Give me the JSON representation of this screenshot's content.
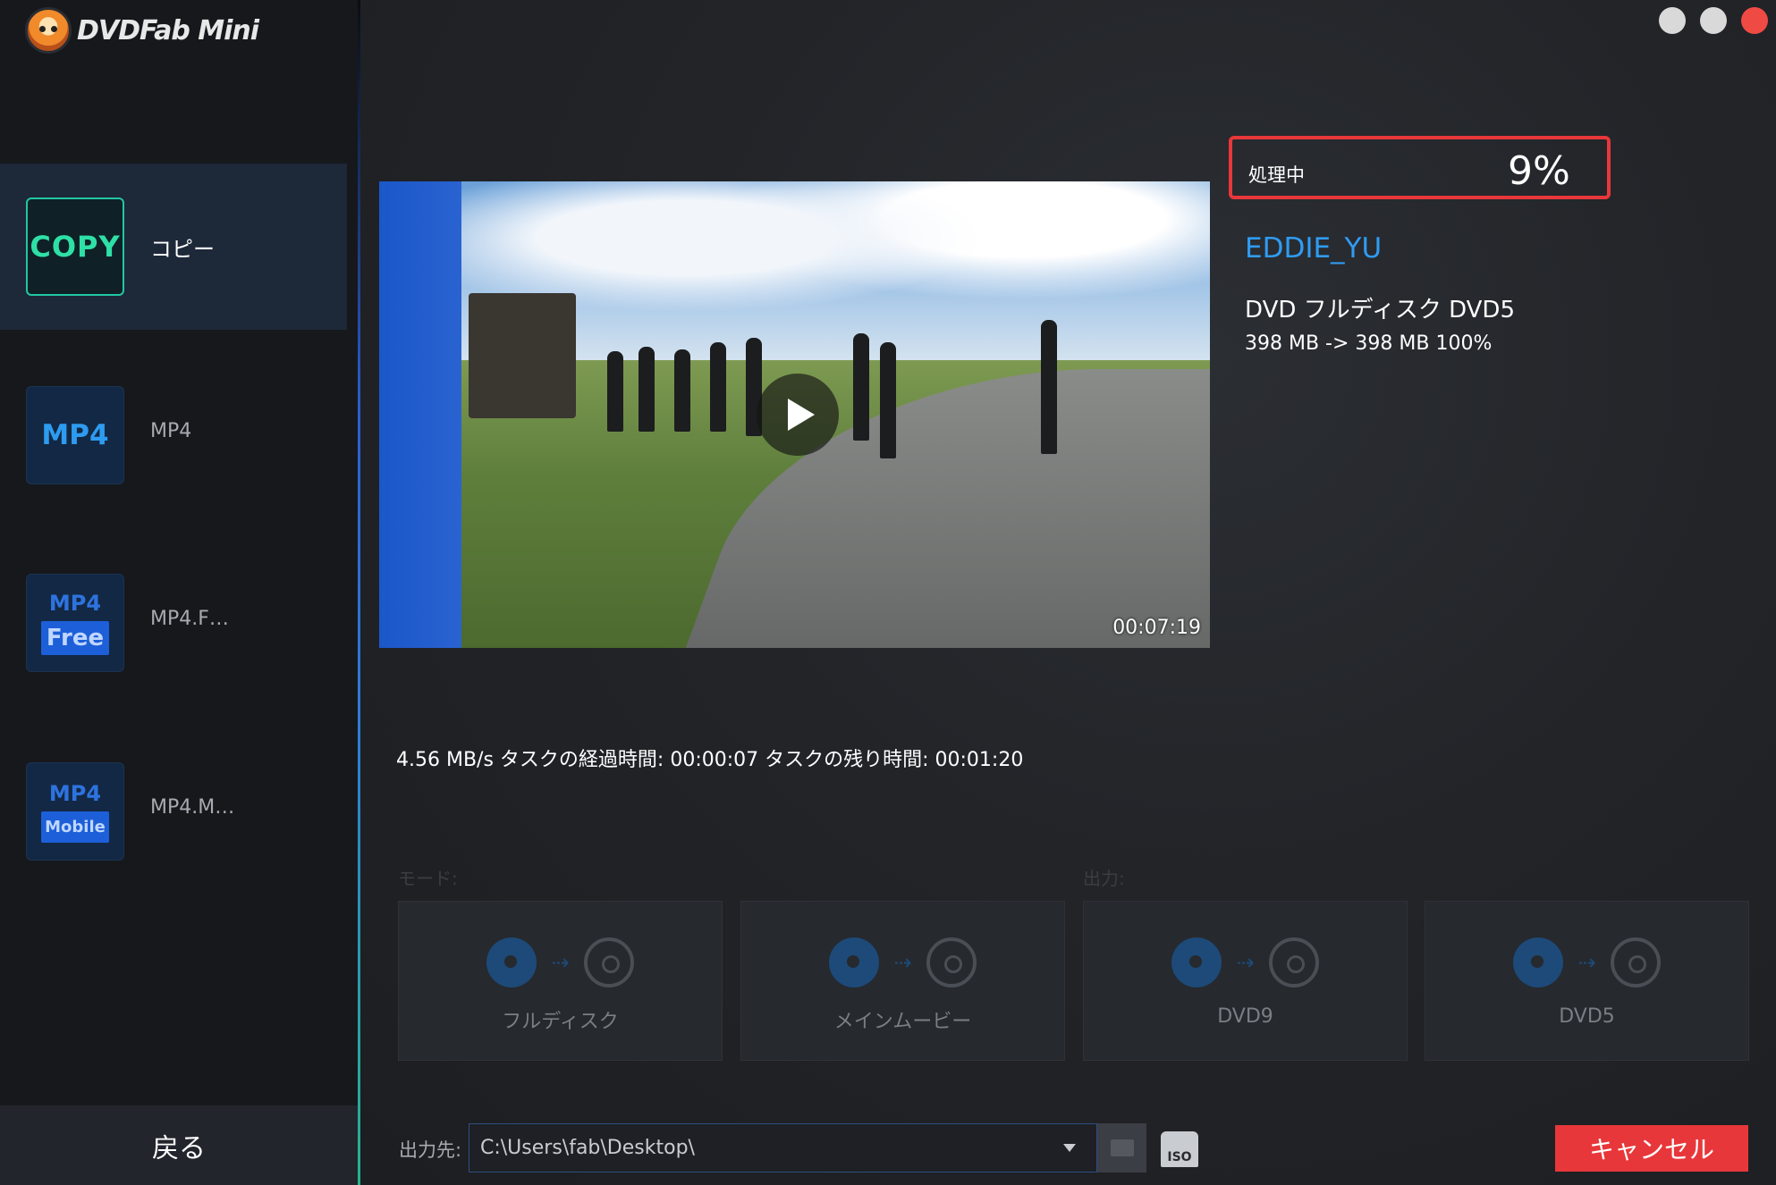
{
  "app": {
    "logo_text": "DVDFab Mini"
  },
  "sidebar": {
    "items": [
      {
        "badge": "COPY",
        "label": "コピー",
        "active": true
      },
      {
        "badge": "MP4",
        "label": "MP4",
        "active": false
      },
      {
        "badge_top": "MP4",
        "badge_box": "Free",
        "label": "MP4.F…",
        "active": false
      },
      {
        "badge_top": "MP4",
        "badge_box": "Mobile",
        "label": "MP4.M…",
        "active": false
      }
    ],
    "back_label": "戻る"
  },
  "video": {
    "timestamp": "00:07:19",
    "icons": [
      "play-icon"
    ]
  },
  "progress": {
    "label": "処理中",
    "value": "9%"
  },
  "info": {
    "name": "EDDIE_YU",
    "type": "DVD フルディスク DVD5",
    "size": "398 MB -> 398 MB  100%"
  },
  "task_stats": "4.56 MB/s  タスクの経過時間: 00:00:07  タスクの残り時間: 00:01:20",
  "sections": {
    "mode_label": "モード:",
    "output_label": "出力:"
  },
  "modes": [
    {
      "label": "フルディスク",
      "icons": [
        "disc-icon",
        "arrow-icon",
        "disc-icon"
      ]
    },
    {
      "label": "メインムービー",
      "icons": [
        "film-reel-icon",
        "arrow-icon",
        "disc-icon"
      ]
    },
    {
      "label": "DVD9",
      "icons": [
        "disc-icon",
        "arrow-icon",
        "dvd9-disc-icon"
      ]
    },
    {
      "label": "DVD5",
      "icons": [
        "disc-icon",
        "arrow-icon",
        "dvd5-disc-icon"
      ]
    }
  ],
  "output": {
    "label": "出力先:",
    "path": "C:\\Users\\fab\\Desktop\\",
    "iso_label": "ISO"
  },
  "cancel_label": "キャンセル",
  "colors": {
    "accent_blue": "#2f9cf2",
    "accent_green": "#21c7a3",
    "danger_red": "#e8373a",
    "sidebar_bg": "#16181c"
  }
}
